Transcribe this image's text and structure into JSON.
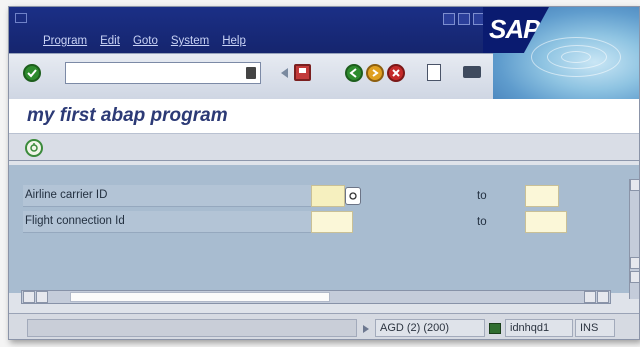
{
  "window": {
    "menu": [
      "Program",
      "Edit",
      "Goto",
      "System",
      "Help"
    ]
  },
  "brand": {
    "logo_text": "SAP"
  },
  "toolbar": {
    "command_value": "",
    "icons": [
      "enter-icon",
      "save-icon",
      "back-icon",
      "exit-icon",
      "cancel-icon",
      "print-icon",
      "find-icon"
    ]
  },
  "screen": {
    "title": "my first abap program",
    "app_toolbar_icon": "execute-icon"
  },
  "selection": {
    "rows": [
      {
        "label": "Airline carrier ID",
        "low": "",
        "to": "to",
        "high": ""
      },
      {
        "label": "Flight connection Id",
        "low": "",
        "to": "to",
        "high": ""
      }
    ]
  },
  "status": {
    "message": "",
    "system": "AGD (2) (200)",
    "server": "idnhqd1",
    "mode": "INS"
  },
  "colors": {
    "menubar": "#1b2f86",
    "input_bg": "#fbf7d8",
    "main_bg": "#a8bcd0"
  }
}
